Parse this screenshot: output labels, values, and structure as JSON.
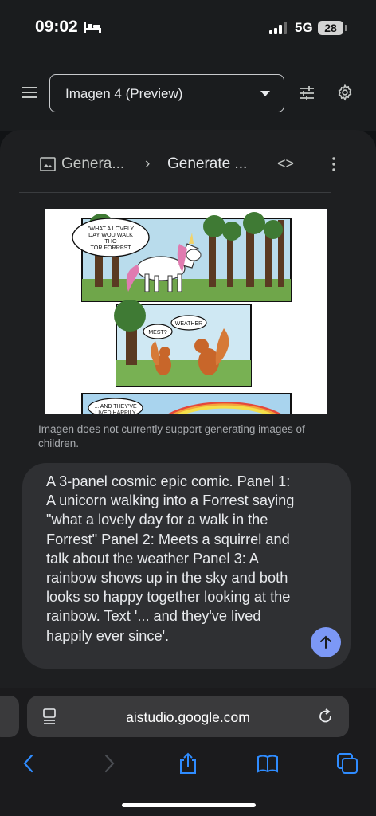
{
  "status_bar": {
    "time": "09:02",
    "network": "5G",
    "battery": "28"
  },
  "header": {
    "model_name": "Imagen 4 (Preview)"
  },
  "breadcrumb": {
    "parent": "Genera...",
    "current": "Generate ...",
    "code_label": "<>"
  },
  "comic": {
    "panel1_bubble": "\"WHAT A LOVELY\nDAY WOU WALK\nTHO\nTOR FORRFST",
    "panel2_bubble_left": "MEST?",
    "panel2_bubble_right": "WEATHER",
    "panel3_bubble": "... AND THEY'VE\nLIVED HAPPILY"
  },
  "warning": "Imagen does not currently support generating images of children.",
  "prompt": {
    "text": "A 3-panel cosmic epic comic. Panel 1: A unicorn walking into a Forrest saying \"what a lovely day for a walk in the Forrest\" Panel 2: Meets a squirrel and talk about the weather Panel 3: A rainbow shows up in the sky and both looks so happy together looking at the rainbow. Text '... and they've lived happily ever since'."
  },
  "browser": {
    "url": "aistudio.google.com"
  },
  "colors": {
    "send_button": "#7c98f6",
    "link_blue": "#2f8cff",
    "background": "#1e1f21"
  }
}
